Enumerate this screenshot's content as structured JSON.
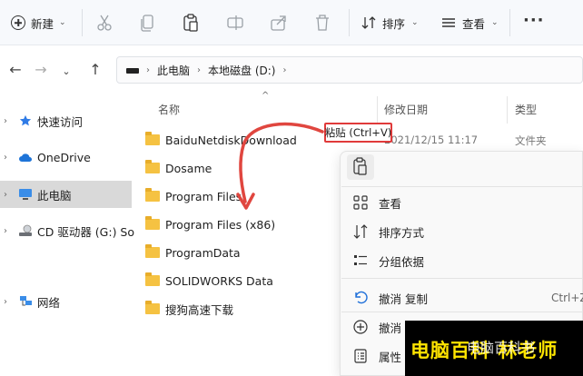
{
  "toolbar": {
    "new_label": "新建",
    "sort_label": "排序",
    "view_label": "查看",
    "more_label": "···"
  },
  "address": {
    "crumbs": [
      "此电脑",
      "本地磁盘 (D:)"
    ]
  },
  "sidebar": {
    "items": [
      {
        "label": "快速访问",
        "icon": "star-icon"
      },
      {
        "label": "OneDrive",
        "icon": "cloud-icon"
      },
      {
        "label": "此电脑",
        "icon": "monitor-icon"
      },
      {
        "label": "CD 驱动器 (G:) So",
        "icon": "cd-drive-icon"
      },
      {
        "label": "网络",
        "icon": "network-icon"
      }
    ]
  },
  "columns": {
    "name": "名称",
    "date": "修改日期",
    "type": "类型"
  },
  "files": [
    {
      "name": "BaiduNetdiskDownload",
      "date": "2021/12/15 11:17",
      "type": "文件夹"
    },
    {
      "name": "Dosame"
    },
    {
      "name": "Program Files"
    },
    {
      "name": "Program Files (x86)"
    },
    {
      "name": "ProgramData"
    },
    {
      "name": "SOLIDWORKS Data"
    },
    {
      "name": "搜狗高速下载"
    }
  ],
  "tooltip": {
    "text": "粘贴 (Ctrl+V)"
  },
  "context_menu": {
    "items": [
      {
        "label": "查看",
        "icon": "grid-icon"
      },
      {
        "label": "排序方式",
        "icon": "sort-icon"
      },
      {
        "label": "分组依据",
        "icon": "group-icon"
      },
      {
        "label": "撤消 复制",
        "icon": "undo-icon",
        "shortcut": "Ctrl+Z"
      },
      {
        "label": "撤消",
        "icon": "add-circle-icon"
      },
      {
        "label": "属性",
        "icon": "properties-icon"
      }
    ]
  },
  "watermark": {
    "text": "电脑百科 林老师",
    "sub": "电脑百科书"
  },
  "colors": {
    "highlight_red": "#e03a3a",
    "folder_yellow": "#f5c242",
    "watermark_yellow": "#ffe400"
  }
}
